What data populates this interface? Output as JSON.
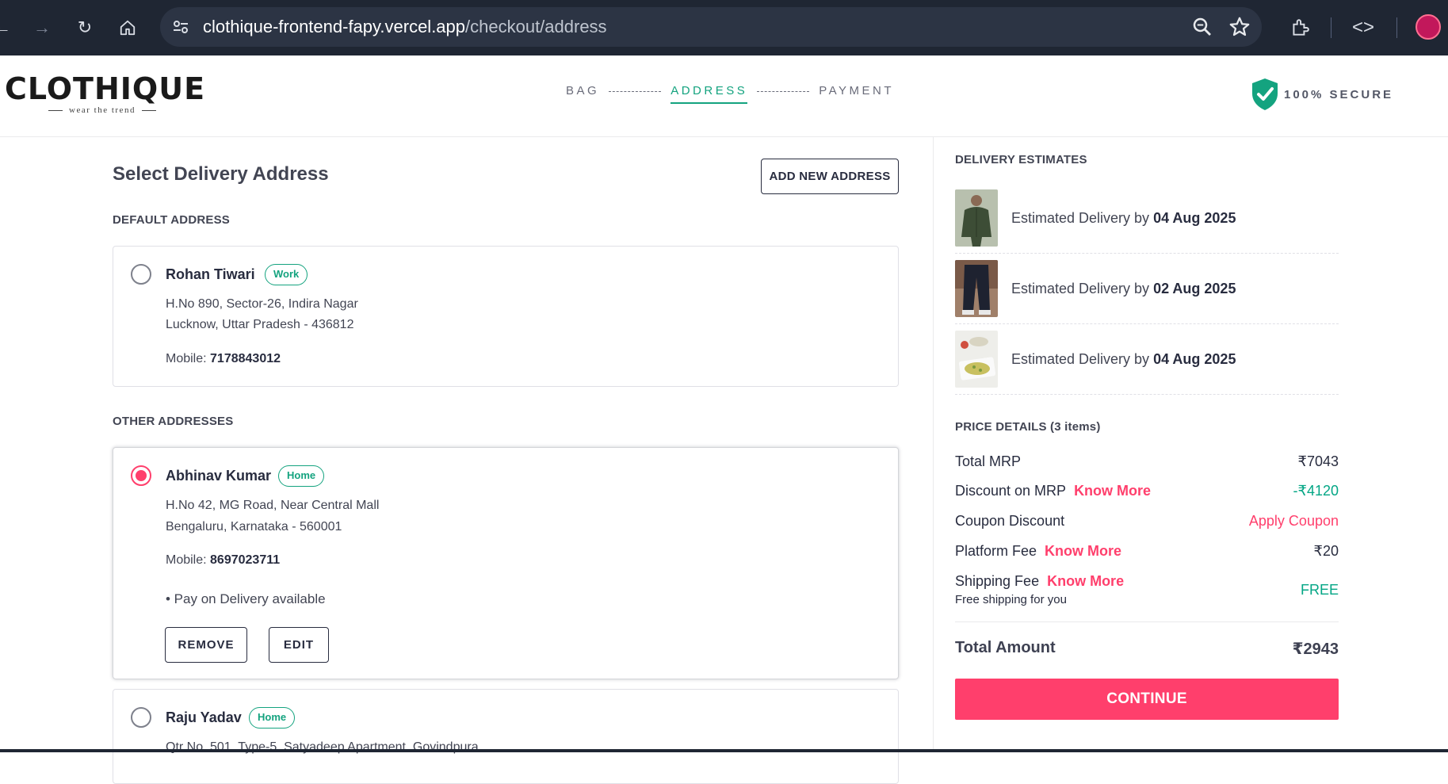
{
  "browser": {
    "url_host": "clothique-frontend-fapy.vercel.app",
    "url_path": "/checkout/address",
    "icons": [
      "back-icon",
      "forward-icon",
      "reload-icon",
      "home-icon",
      "site-settings-icon",
      "zoom-icon",
      "bookmark-star-icon",
      "extensions-icon",
      "devtools-icon",
      "profile-icon"
    ]
  },
  "header": {
    "logo": "CLOTHIQUE",
    "tagline": "wear the trend",
    "steps": [
      "BAG",
      "ADDRESS",
      "PAYMENT"
    ],
    "active_step": "ADDRESS",
    "secure_label": "100% SECURE",
    "accent": "#14a37f"
  },
  "address_page": {
    "title": "Select Delivery Address",
    "add_button": "ADD NEW ADDRESS",
    "default_label": "DEFAULT ADDRESS",
    "other_label": "OTHER ADDRESSES",
    "default_address": {
      "name": "Rohan Tiwari",
      "tag": "Work",
      "line1": "H.No 890, Sector-26, Indira Nagar",
      "line2": "Lucknow, Uttar Pradesh - 436812",
      "mobile_label": "Mobile: ",
      "mobile": "7178843012",
      "selected": false
    },
    "other_addresses": [
      {
        "name": "Abhinav Kumar",
        "tag": "Home",
        "line1": "H.No 42, MG Road, Near Central Mall",
        "line2": "Bengaluru, Karnataka - 560001",
        "mobile_label": "Mobile: ",
        "mobile": "8697023711",
        "pod": "• Pay on Delivery available",
        "remove": "REMOVE",
        "edit": "EDIT",
        "selected": true
      },
      {
        "name": "Raju Yadav",
        "tag": "Home",
        "line1": "Qtr No. 501, Type-5, Satyadeep Apartment, Govindpura",
        "selected": false
      }
    ]
  },
  "delivery": {
    "title": "DELIVERY ESTIMATES",
    "prefix": "Estimated Delivery by ",
    "items": [
      {
        "date": "04 Aug 2025",
        "thumb": "jacket-image"
      },
      {
        "date": "02 Aug 2025",
        "thumb": "trousers-image"
      },
      {
        "date": "04 Aug 2025",
        "thumb": "food-plate-image"
      }
    ]
  },
  "price": {
    "title": "PRICE DETAILS (3 items)",
    "total_mrp_label": "Total MRP",
    "total_mrp": "₹7043",
    "discount_label": "Discount on MRP",
    "discount": "-₹4120",
    "coupon_label": "Coupon Discount",
    "coupon_action": "Apply Coupon",
    "platform_label": "Platform Fee",
    "platform": "₹20",
    "shipping_label": "Shipping Fee",
    "shipping": "FREE",
    "shipping_note": "Free shipping for you",
    "know_more": "Know More",
    "total_label": "Total Amount",
    "total": "₹2943",
    "continue": "CONTINUE",
    "brand_pink": "#ff3f6c",
    "discount_green": "#03a685"
  }
}
